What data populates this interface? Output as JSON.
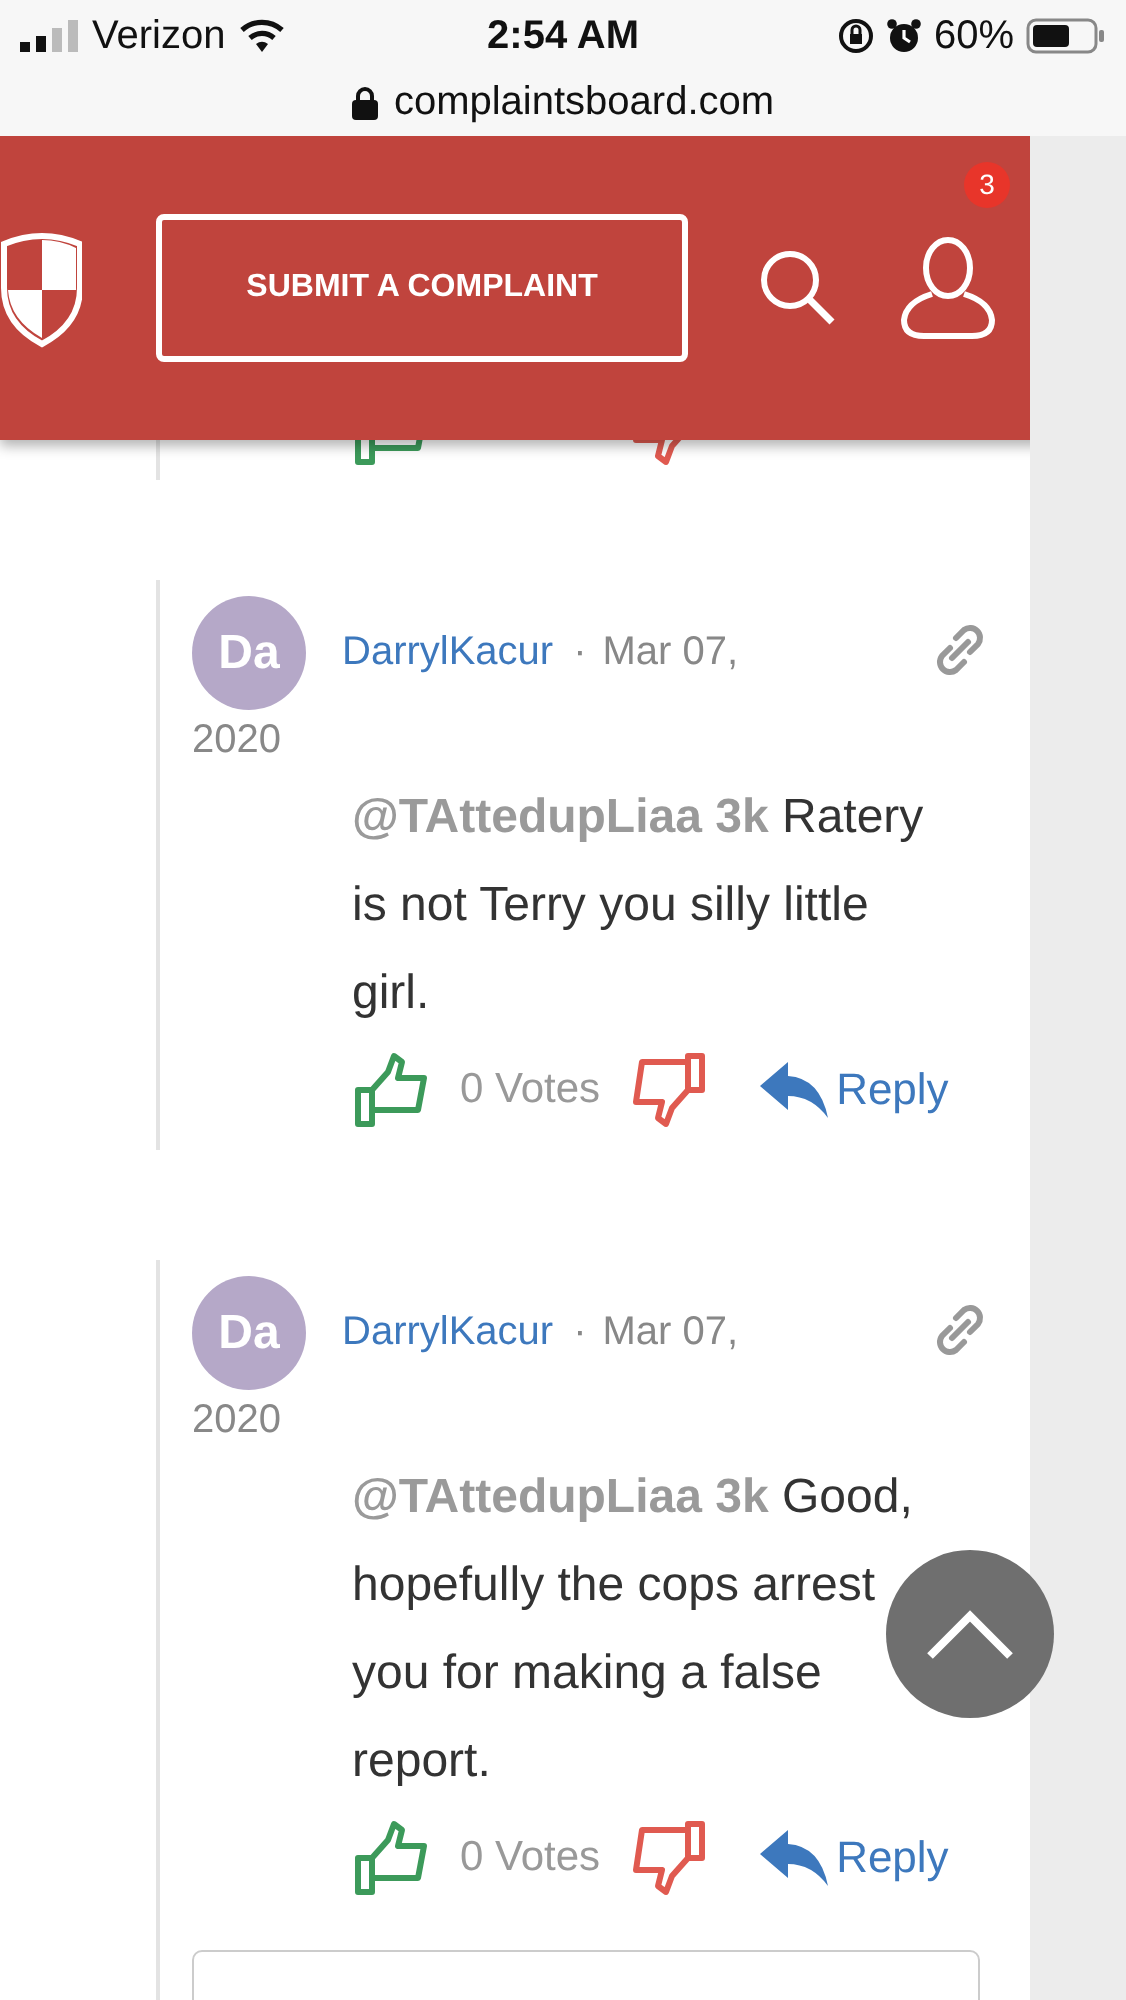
{
  "status_bar": {
    "carrier": "Verizon",
    "time": "2:54 AM",
    "battery": "60%"
  },
  "address_bar": {
    "url": "complaintsboard.com"
  },
  "header": {
    "button": "SUBMIT A COMPLAINT",
    "notification_count": "3"
  },
  "comments": [
    {
      "avatar": "Da",
      "author": "DarrylKacur",
      "separator": "·",
      "date": "Mar 07,",
      "year": "2020",
      "mention": "@TAttedupLiaa 3k",
      "body": " Ratery is not Terry you silly little girl.",
      "votes": "0 Votes",
      "reply": "Reply",
      "reply_box": false
    },
    {
      "avatar": "Da",
      "author": "DarrylKacur",
      "separator": "·",
      "date": "Mar 07,",
      "year": "2020",
      "mention": "@TAttedupLiaa 3k",
      "body": " Good, hopefully the cops arrest you for making a false report.",
      "votes": "0 Votes",
      "reply": "Reply",
      "reply_box": true
    }
  ]
}
